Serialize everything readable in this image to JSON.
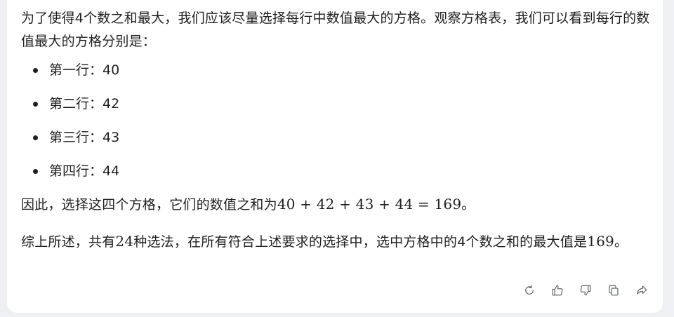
{
  "message": {
    "intro": "为了使得4个数之和最大，我们应该尽量选择每行中数值最大的方格。观察方格表，我们可以看到每行的数值最大的方格分别是：",
    "rows": [
      {
        "label": "第一行：",
        "value": "40"
      },
      {
        "label": "第二行：",
        "value": "42"
      },
      {
        "label": "第三行：",
        "value": "43"
      },
      {
        "label": "第四行：",
        "value": "44"
      }
    ],
    "since_prefix": "因此，选择这四个方格，它们的数值之和为",
    "since_math": "40 + 42 + 43 + 44 = 169",
    "since_suffix": "。",
    "summary_a": "综上所述，共有",
    "summary_num1": "24",
    "summary_b": "种选法，在所有符合上述要求的选择中，选中方格中的4个数之和的最大值是",
    "summary_num2": "169",
    "summary_c": "。"
  },
  "actions": {
    "icons": [
      "refresh-icon",
      "thumbs-up-icon",
      "thumbs-down-icon",
      "copy-icon",
      "share-icon"
    ]
  }
}
